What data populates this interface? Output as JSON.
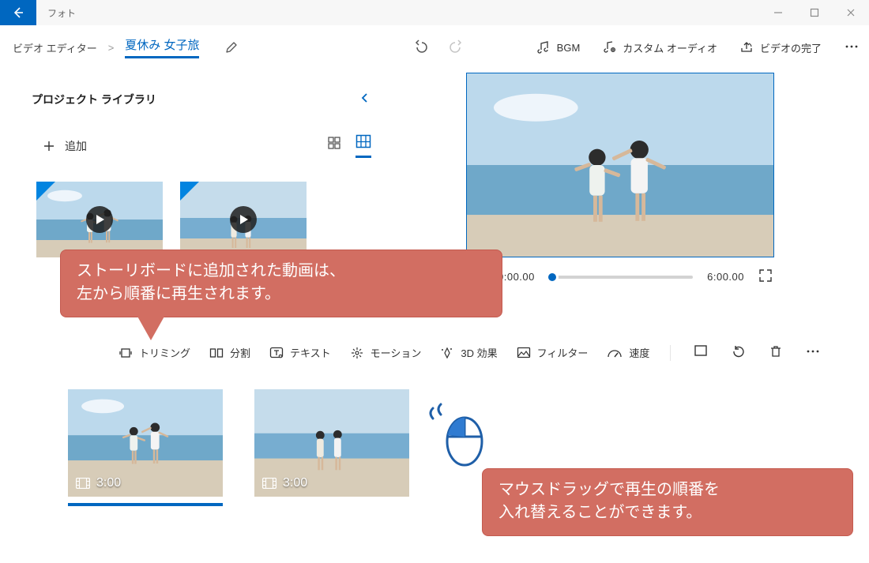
{
  "titlebar": {
    "app_name": "フォト"
  },
  "crumb": {
    "root": "ビデオ エディター",
    "sep": ">",
    "title": "夏休み 女子旅"
  },
  "top_actions": {
    "bgm": "BGM",
    "custom_audio": "カスタム オーディオ",
    "finish": "ビデオの完了"
  },
  "library": {
    "title": "プロジェクト ライブラリ",
    "add": "追加"
  },
  "player": {
    "current_time": "0:00.00",
    "total_time": "6:00.00"
  },
  "tools": {
    "trim": "トリミング",
    "split": "分割",
    "text": "テキスト",
    "motion": "モーション",
    "fx3d": "3D 効果",
    "filter": "フィルター",
    "speed": "速度"
  },
  "clips": [
    {
      "duration": "3:00"
    },
    {
      "duration": "3:00"
    }
  ],
  "callouts": {
    "c1_line1": "ストーリボードに追加された動画は、",
    "c1_line2": "左から順番に再生されます。",
    "c2_line1": "マウスドラッグで再生の順番を",
    "c2_line2": "入れ替えることができます。"
  }
}
